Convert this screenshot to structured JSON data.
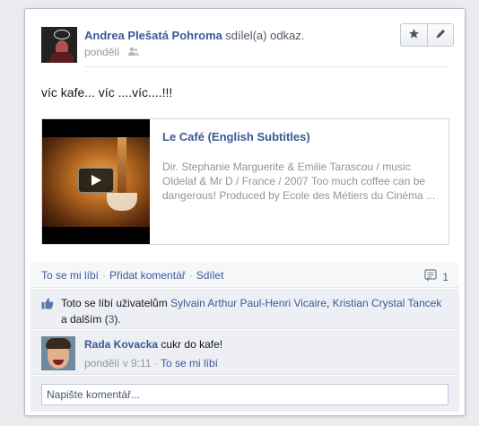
{
  "post": {
    "author": "Andrea Plešatá Pohroma",
    "action": "sdílel(a) odkaz.",
    "time": "pondělí",
    "status": "víc kafe... víc ....víc....!!!"
  },
  "header_buttons": {
    "star_icon": "star-icon",
    "edit_icon": "pencil-icon"
  },
  "share": {
    "title": "Le Café (English Subtitles)",
    "description": "Dir. Stephanie Marguerite & Emilie Tarascou / music Oldelaf & Mr D / France / 2007 Too much coffee can be dangerous! Produced by Ecole des Métiers du Cinéma ..."
  },
  "actions": {
    "like": "To se mi líbí",
    "comment": "Přidat komentář",
    "share": "Sdílet",
    "comment_count": "1"
  },
  "likes": {
    "prefix": "Toto se líbí uživatelům",
    "user1": "Sylvain Arthur Paul-Henri Vicaire",
    "user2": "Kristian Crystal Tancek",
    "and_others": "a dalším",
    "others_count": "3"
  },
  "comment": {
    "author": "Rada Kovacka",
    "text": "cukr do kafe!",
    "time": "pondělí v 9:11",
    "like": "To se mi líbí"
  },
  "reply": {
    "placeholder": "Napište komentář..."
  },
  "colors": {
    "link": "#3b5998",
    "background": "#e9ebee",
    "muted": "#9197a3"
  }
}
